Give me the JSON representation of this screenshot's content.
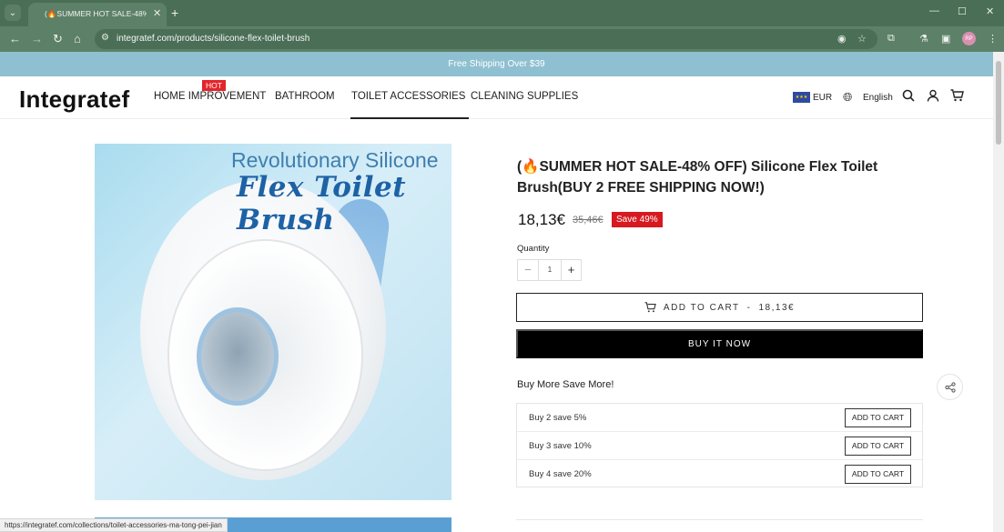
{
  "browser": {
    "tab_title": "(🔥SUMMER HOT SALE-48% O",
    "url": "integratef.com/products/silicone-flex-toilet-brush",
    "profile_initials": "RP",
    "status_url": "https://integratef.com/collections/toilet-accessories-ma-tong-pei-jian"
  },
  "announcement": "Free Shipping Over $39",
  "header": {
    "logo": "Integratef",
    "nav": [
      "HOME IMPROVEMENT",
      "BATHROOM",
      "TOILET ACCESSORIES",
      "CLEANING SUPPLIES"
    ],
    "hot_badge": "HOT",
    "active_nav": "TOILET ACCESSORIES",
    "currency": "EUR",
    "language": "English"
  },
  "product": {
    "image_headline": "Revolutionary Silicone",
    "image_subheadline": "Flex Toilet Brush",
    "title": "(🔥SUMMER HOT SALE-48% OFF) Silicone Flex Toilet Brush(BUY 2 FREE SHIPPING NOW!)",
    "price": "18,13€",
    "compare_price": "35,46€",
    "save_badge": "Save 49%",
    "quantity_label": "Quantity",
    "quantity": "1",
    "add_to_cart_label": "ADD TO CART",
    "add_to_cart_separator": "-",
    "add_to_cart_price": "18,13€",
    "buy_now_label": "BUY IT NOW"
  },
  "bundle": {
    "title": "Buy More Save More!",
    "rows": [
      {
        "label": "Buy 2 save 5%",
        "button": "ADD TO CART"
      },
      {
        "label": "Buy 3 save 10%",
        "button": "ADD TO CART"
      },
      {
        "label": "Buy 4 save 20%",
        "button": "ADD TO CART"
      }
    ]
  },
  "icons": {
    "tab_menu": "chevron-down-icon",
    "close_tab": "close-icon",
    "new_tab": "plus-icon",
    "back": "arrow-left-icon",
    "forward": "arrow-right-icon",
    "reload": "reload-icon",
    "home": "home-icon",
    "site_info": "tune-icon",
    "eye_off": "eye-off-icon",
    "bookmark": "star-icon",
    "extensions": "puzzle-icon",
    "labs": "flask-icon",
    "sidebar": "sidebar-icon",
    "menu": "kebab-menu-icon",
    "search": "search-icon",
    "account": "user-icon",
    "cart": "cart-icon",
    "globe": "globe-icon",
    "share": "share-icon"
  },
  "colors": {
    "chrome": "#5d8068",
    "announcement_bg": "#8fc0d1",
    "hot_badge": "#e3242b",
    "save_badge": "#d71920",
    "buy_now_bg": "#000000"
  }
}
